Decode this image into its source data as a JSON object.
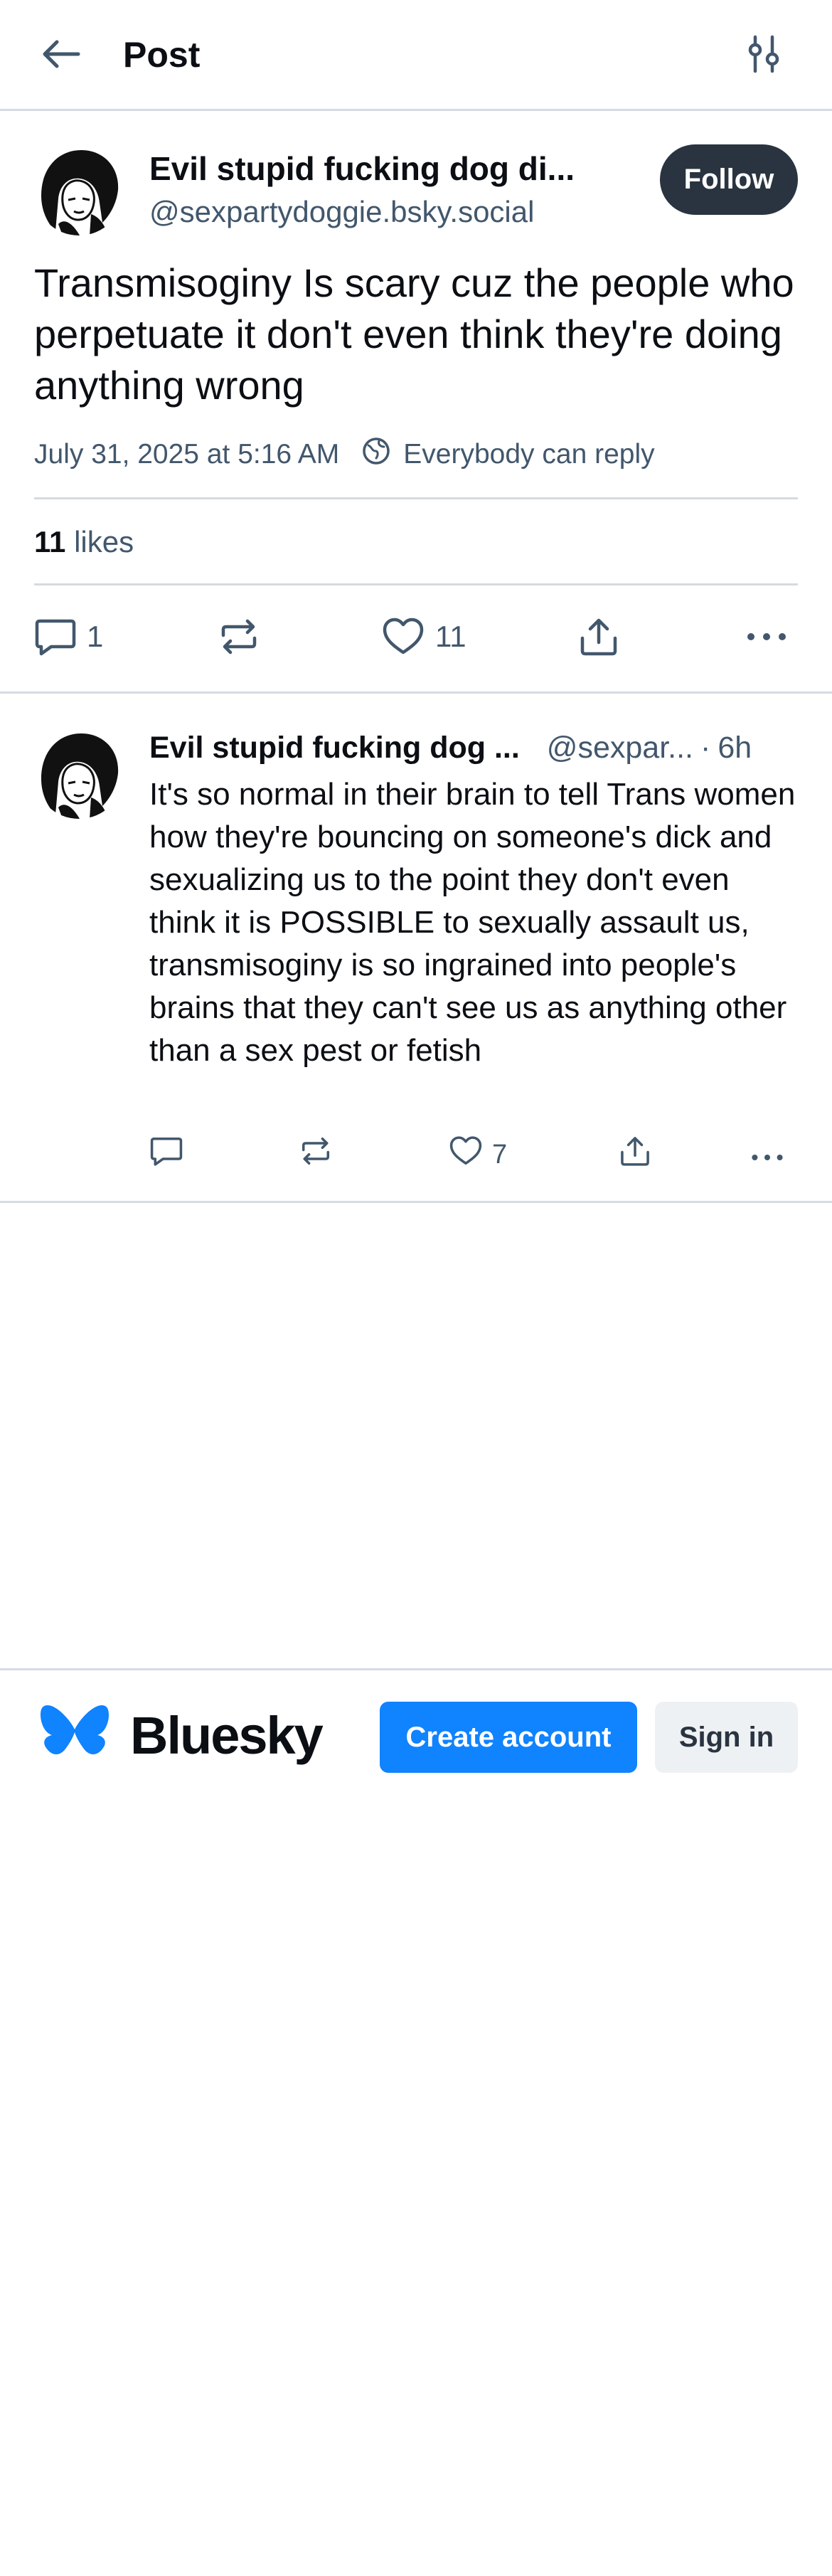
{
  "header": {
    "title": "Post",
    "back_icon": "arrow-left-icon",
    "filter_icon": "sliders-icon"
  },
  "main_post": {
    "author_name": "Evil stupid fucking dog di...",
    "author_handle": "@sexpartydoggie.bsky.social",
    "follow_label": "Follow",
    "text": "Transmisoginy Is scary cuz the people who perpetuate it don't even think they're doing anything wrong",
    "timestamp": "July 31, 2025 at 5:16 AM",
    "reply_setting": "Everybody can reply",
    "likes_count": "11",
    "likes_label": "likes",
    "actions": {
      "reply_count": "1",
      "repost_count": "",
      "like_count": "11"
    }
  },
  "reply": {
    "author_name": "Evil stupid fucking dog ...",
    "author_handle": "@sexpar...",
    "dot": "·",
    "time": "6h",
    "text": "It's so normal in their brain to tell Trans women how they're bouncing on someone's dick and sexualizing us to the point they don't even think it is POSSIBLE to sexually assault us, transmisoginy is so ingrained into people's brains that they can't see us as anything other than a sex pest or fetish",
    "actions": {
      "reply_count": "",
      "repost_count": "",
      "like_count": "7"
    }
  },
  "footer": {
    "brand": "Bluesky",
    "create_account_label": "Create account",
    "sign_in_label": "Sign in"
  },
  "colors": {
    "accent": "#1083fe",
    "follow_bg": "#2a3440",
    "muted_text": "#42576c",
    "border": "#d4dbe2"
  }
}
